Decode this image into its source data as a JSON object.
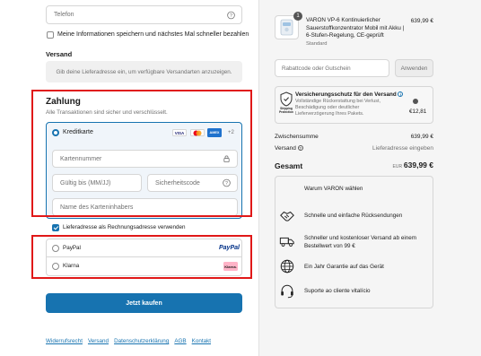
{
  "contact": {
    "phone_placeholder": "Telefon",
    "save_info_label": "Meine Informationen speichern und nächstes Mal schneller bezahlen"
  },
  "shipping": {
    "heading": "Versand",
    "placeholder_text": "Gib deine Lieferadresse ein, um verfügbare Versandarten anzuzeigen."
  },
  "payment": {
    "heading": "Zahlung",
    "subtitle": "Alle Transaktionen sind sicher und verschlüsselt.",
    "card_option_label": "Kreditkarte",
    "card_brands": [
      "VISA",
      "MC",
      "AMEX"
    ],
    "more_brands": "+2",
    "card_number_placeholder": "Kartennummer",
    "expiry_placeholder": "Gültig bis (MM/JJ)",
    "cvc_placeholder": "Sicherheitscode",
    "name_placeholder": "Name des Karteninhabers",
    "billing_same_label": "Lieferadresse als Rechnungsadresse verwenden",
    "paypal_label": "PayPal",
    "paypal_logo": "PayPal",
    "klarna_label": "Klarna",
    "klarna_logo": "Klarna."
  },
  "buy_button": "Jetzt kaufen",
  "footer_links": [
    "Widerrufsrecht",
    "Versand",
    "Datenschutzerklärung",
    "AGB",
    "Kontakt"
  ],
  "order": {
    "quantity": "1",
    "product_title": "VARON VP-6 Kontinuierlicher Sauerstoffkonzentrator Mobil mit Akku | 6-Stufen-Regelung, CE-geprüft",
    "product_variant": "Standard",
    "product_price": "639,99 €",
    "discount_placeholder": "Rabattcode oder Gutschein",
    "apply_button": "Anwenden",
    "insurance_title": "Versicherungsschutz für den Versand",
    "insurance_desc": "Vollständige Rückerstattung bei Verlust, Beschädigung oder deutlicher Lieferverzögerung Ihres Pakets.",
    "insurance_badge_text": "Shipping Protection",
    "insurance_price": "€12,81",
    "subtotal_label": "Zwischensumme",
    "subtotal_value": "639,99 €",
    "shipping_label": "Versand",
    "shipping_value": "Lieferadresse eingeben",
    "total_label": "Gesamt",
    "total_currency": "EUR",
    "total_value": "639,99 €"
  },
  "why": {
    "heading": "Warum VARON wählen",
    "items": [
      {
        "icon": "handshake-icon",
        "text": "Schnelle und einfache Rücksendungen"
      },
      {
        "icon": "truck-icon",
        "text": "Schneller und kostenloser Versand ab einem Bestellwert von 99 €"
      },
      {
        "icon": "globe-icon",
        "text": "Ein Jahr Garantie auf das Gerät"
      },
      {
        "icon": "headset-icon",
        "text": "Suporte ao cliente vitalício"
      }
    ]
  },
  "colors": {
    "accent": "#1773b0",
    "highlight": "#e01818"
  }
}
